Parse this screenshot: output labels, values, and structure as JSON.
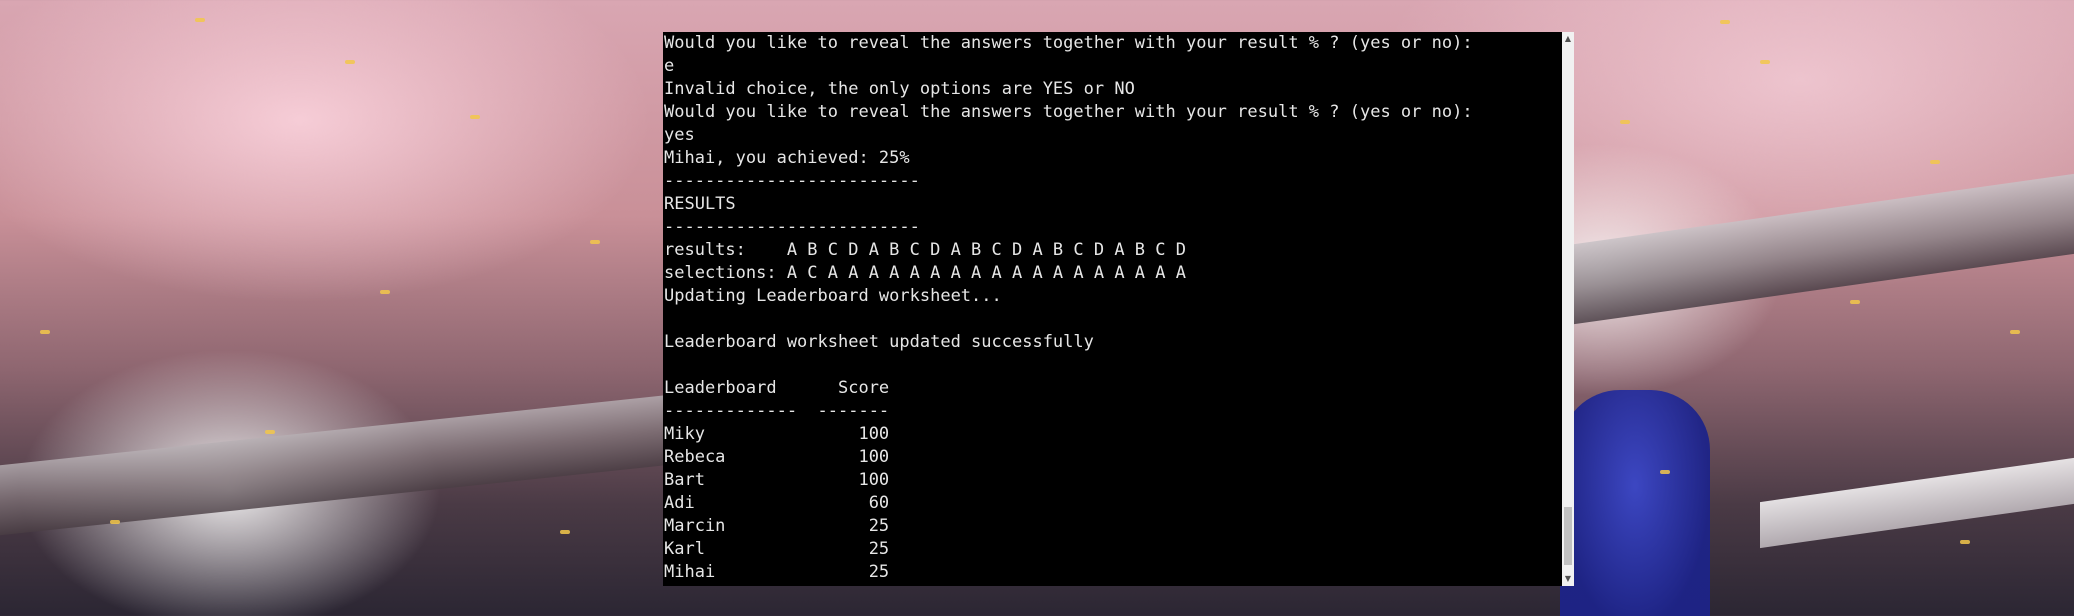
{
  "terminal": {
    "lines": [
      "Would you like to reveal the answers together with your result % ? (yes or no):",
      "e",
      "Invalid choice, the only options are YES or NO",
      "Would you like to reveal the answers together with your result % ? (yes or no):",
      "yes",
      "Mihai, you achieved: 25%",
      "-------------------------",
      "RESULTS",
      "-------------------------",
      "results:    A B C D A B C D A B C D A B C D A B C D",
      "selections: A C A A A A A A A A A A A A A A A A A A",
      "Updating Leaderboard worksheet...",
      "",
      "Leaderboard worksheet updated successfully",
      "",
      "Leaderboard      Score",
      "-------------  -------",
      "Miky               100",
      "Rebeca             100",
      "Bart               100",
      "Adi                 60",
      "Marcin              25",
      "Karl                25",
      "Mihai               25"
    ]
  },
  "scrollbar": {
    "up_arrow": "▲",
    "down_arrow": "▼",
    "position": 1.0
  },
  "colors": {
    "terminal_bg": "#000000",
    "terminal_text": "#e6e6e6",
    "confetti": "#f2c74a"
  }
}
